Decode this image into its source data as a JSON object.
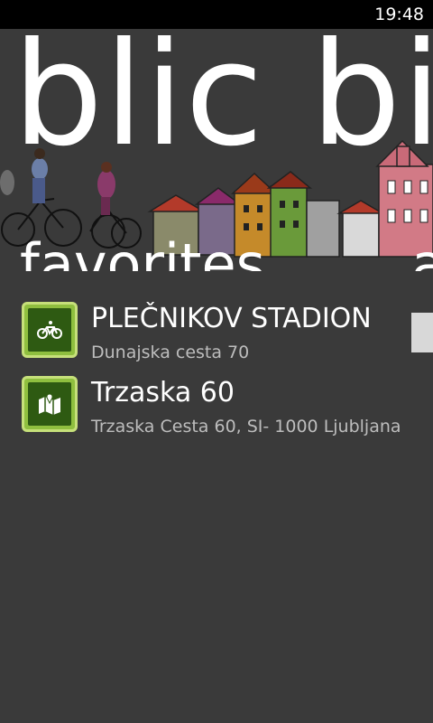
{
  "status_bar": {
    "time": "19:48"
  },
  "panorama": {
    "title": "blic bi"
  },
  "pivot": {
    "current": "favorites",
    "next": "a"
  },
  "favorites": [
    {
      "name": "PLEČNIKOV STADION",
      "address": "Dunajska cesta 70",
      "icon": "bicycle-icon"
    },
    {
      "name": "Trzaska 60",
      "address": "Trzaska Cesta 60, SI- 1000 Ljubljana",
      "icon": "map-icon"
    }
  ],
  "colors": {
    "background": "#3a3a3a",
    "tile_border": "#c6e07a",
    "tile_fill": "#2e5a12",
    "subtitle": "#bdbdbd"
  }
}
